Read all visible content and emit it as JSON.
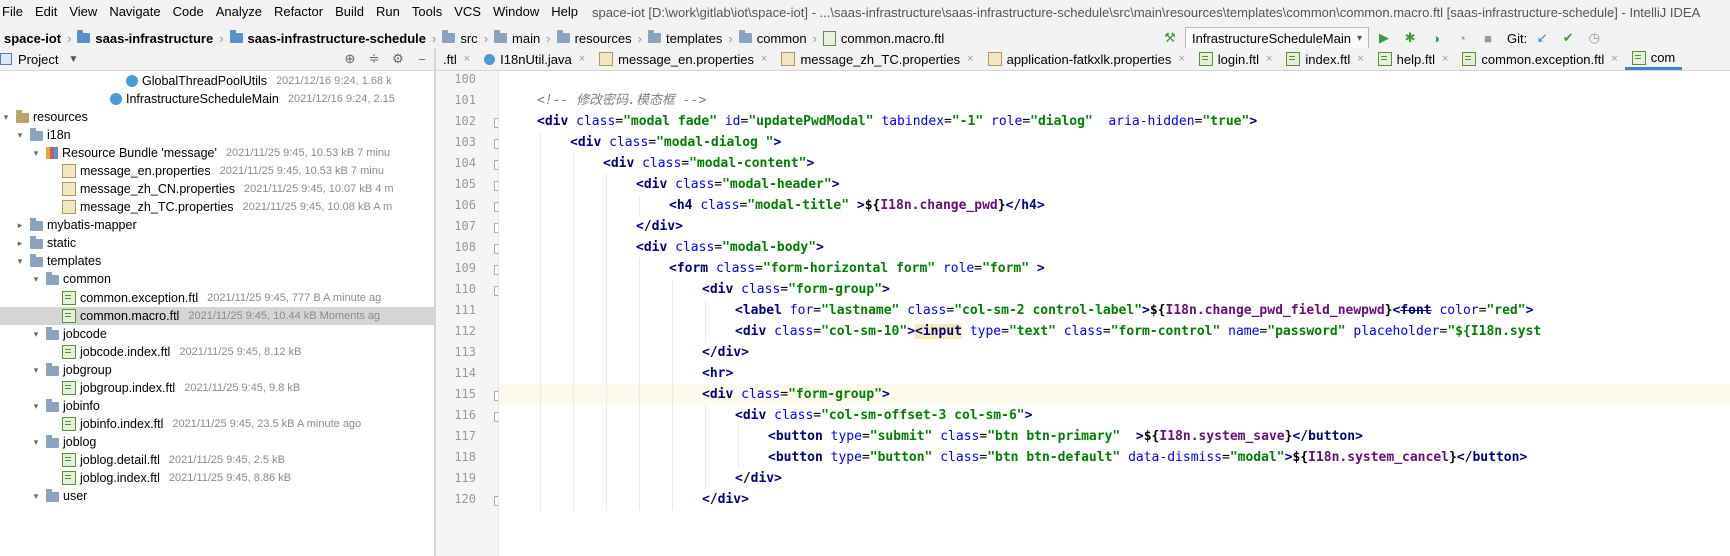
{
  "menu": [
    "File",
    "Edit",
    "View",
    "Navigate",
    "Code",
    "Analyze",
    "Refactor",
    "Build",
    "Run",
    "Tools",
    "VCS",
    "Window",
    "Help"
  ],
  "window_title": "space-iot [D:\\work\\gitlab\\iot\\space-iot] - ...\\saas-infrastructure\\saas-infrastructure-schedule\\src\\main\\resources\\templates\\common\\common.macro.ftl [saas-infrastructure-schedule] - IntelliJ IDEA",
  "breadcrumb": [
    "space-iot",
    "saas-infrastructure",
    "saas-infrastructure-schedule",
    "src",
    "main",
    "resources",
    "templates",
    "common",
    "common.macro.ftl"
  ],
  "run_config": "InfrastructureScheduleMain",
  "git_label": "Git:",
  "project_panel": {
    "title": "Project",
    "dropdown_icon": "triangle-down-icon",
    "tools": [
      "target-icon",
      "collapse-icon",
      "gear-icon",
      "minimize-icon"
    ]
  },
  "tree": [
    {
      "level": 11,
      "type": "class",
      "name": "GlobalThreadPoolUtils",
      "meta": "2021/12/16 9:24, 1.68 k"
    },
    {
      "level": 10,
      "type": "class",
      "name": "InfrastructureScheduleMain",
      "meta": "2021/12/16 9:24, 2.15"
    },
    {
      "level": 3,
      "type": "res-folder",
      "arrow": "▾",
      "name": "resources",
      "meta": ""
    },
    {
      "level": 4,
      "type": "folder",
      "arrow": "▾",
      "name": "i18n",
      "meta": ""
    },
    {
      "level": 5,
      "type": "bundle",
      "arrow": "▾",
      "name": "Resource Bundle 'message'",
      "meta": "2021/11/25 9:45, 10.53 kB 7 minu"
    },
    {
      "level": 7,
      "type": "props",
      "name": "message_en.properties",
      "meta": "2021/11/25 9:45, 10.53 kB 7 minu"
    },
    {
      "level": 7,
      "type": "props",
      "name": "message_zh_CN.properties",
      "meta": "2021/11/25 9:45, 10.07 kB 4 m"
    },
    {
      "level": 7,
      "type": "props",
      "name": "message_zh_TC.properties",
      "meta": "2021/11/25 9:45, 10.08 kB A m"
    },
    {
      "level": 4,
      "type": "folder",
      "arrow": "▸",
      "name": "mybatis-mapper",
      "meta": ""
    },
    {
      "level": 4,
      "type": "folder",
      "arrow": "▸",
      "name": "static",
      "meta": ""
    },
    {
      "level": 4,
      "type": "folder",
      "arrow": "▾",
      "name": "templates",
      "meta": ""
    },
    {
      "level": 5,
      "type": "folder",
      "arrow": "▾",
      "name": "common",
      "meta": ""
    },
    {
      "level": 7,
      "type": "ftl",
      "name": "common.exception.ftl",
      "meta": "2021/11/25 9:45, 777 B A minute ag"
    },
    {
      "level": 7,
      "type": "ftl",
      "name": "common.macro.ftl",
      "meta": "2021/11/25 9:45, 10.44 kB Moments ag",
      "selected": true
    },
    {
      "level": 5,
      "type": "folder",
      "arrow": "▾",
      "name": "jobcode",
      "meta": ""
    },
    {
      "level": 7,
      "type": "ftl",
      "name": "jobcode.index.ftl",
      "meta": "2021/11/25 9:45, 8.12 kB"
    },
    {
      "level": 5,
      "type": "folder",
      "arrow": "▾",
      "name": "jobgroup",
      "meta": ""
    },
    {
      "level": 7,
      "type": "ftl",
      "name": "jobgroup.index.ftl",
      "meta": "2021/11/25 9:45, 9.8 kB"
    },
    {
      "level": 5,
      "type": "folder",
      "arrow": "▾",
      "name": "jobinfo",
      "meta": ""
    },
    {
      "level": 7,
      "type": "ftl",
      "name": "jobinfo.index.ftl",
      "meta": "2021/11/25 9:45, 23.5 kB A minute ago"
    },
    {
      "level": 5,
      "type": "folder",
      "arrow": "▾",
      "name": "joblog",
      "meta": ""
    },
    {
      "level": 7,
      "type": "ftl",
      "name": "joblog.detail.ftl",
      "meta": "2021/11/25 9:45, 2.5 kB"
    },
    {
      "level": 7,
      "type": "ftl",
      "name": "joblog.index.ftl",
      "meta": "2021/11/25 9:45, 8.86 kB"
    },
    {
      "level": 5,
      "type": "folder",
      "arrow": "▾",
      "name": "user",
      "meta": ""
    }
  ],
  "tabs": [
    {
      "name": ".ftl",
      "icon": "none",
      "active": false
    },
    {
      "name": "I18nUtil.java",
      "icon": "java",
      "active": false
    },
    {
      "name": "message_en.properties",
      "icon": "props",
      "active": false
    },
    {
      "name": "message_zh_TC.properties",
      "icon": "props",
      "active": false
    },
    {
      "name": "application-fatkxlk.properties",
      "icon": "props",
      "active": false
    },
    {
      "name": "login.ftl",
      "icon": "ftl",
      "active": false
    },
    {
      "name": "index.ftl",
      "icon": "ftl",
      "active": false
    },
    {
      "name": "help.ftl",
      "icon": "ftl",
      "active": false
    },
    {
      "name": "common.exception.ftl",
      "icon": "ftl",
      "active": false
    },
    {
      "name": "com",
      "icon": "ftl",
      "active": true
    }
  ],
  "code_lines": [
    {
      "n": "100",
      "indent": 0,
      "segs": []
    },
    {
      "n": "101",
      "indent": 0,
      "segs": [
        [
          "comment",
          "<!-- 修改密码.模态框 -->"
        ]
      ]
    },
    {
      "n": "102",
      "indent": 0,
      "segs": [
        [
          "tag",
          "<div"
        ],
        [
          "plain",
          " "
        ],
        [
          "attr",
          "class"
        ],
        [
          "plain",
          "="
        ],
        [
          "val",
          "\"modal fade\""
        ],
        [
          "plain",
          " "
        ],
        [
          "attr",
          "id"
        ],
        [
          "plain",
          "="
        ],
        [
          "val",
          "\"updatePwdModal\""
        ],
        [
          "plain",
          " "
        ],
        [
          "attr",
          "tabindex"
        ],
        [
          "plain",
          "="
        ],
        [
          "val",
          "\"-1\""
        ],
        [
          "plain",
          " "
        ],
        [
          "attr",
          "role"
        ],
        [
          "plain",
          "="
        ],
        [
          "val",
          "\"dialog\""
        ],
        [
          "plain",
          "  "
        ],
        [
          "attr",
          "aria-hidden"
        ],
        [
          "plain",
          "="
        ],
        [
          "val",
          "\"true\""
        ],
        [
          "tag",
          ">"
        ]
      ]
    },
    {
      "n": "103",
      "indent": 1,
      "segs": [
        [
          "tag",
          "<div"
        ],
        [
          "plain",
          " "
        ],
        [
          "attr",
          "class"
        ],
        [
          "plain",
          "="
        ],
        [
          "val",
          "\"modal-dialog \""
        ],
        [
          "tag",
          ">"
        ]
      ]
    },
    {
      "n": "104",
      "indent": 2,
      "segs": [
        [
          "tag",
          "<div"
        ],
        [
          "plain",
          " "
        ],
        [
          "attr",
          "class"
        ],
        [
          "plain",
          "="
        ],
        [
          "val",
          "\"modal-content\""
        ],
        [
          "tag",
          ">"
        ]
      ]
    },
    {
      "n": "105",
      "indent": 3,
      "segs": [
        [
          "tag",
          "<div"
        ],
        [
          "plain",
          " "
        ],
        [
          "attr",
          "class"
        ],
        [
          "plain",
          "="
        ],
        [
          "val",
          "\"modal-header\""
        ],
        [
          "tag",
          ">"
        ]
      ]
    },
    {
      "n": "106",
      "indent": 4,
      "segs": [
        [
          "tag",
          "<h4"
        ],
        [
          "plain",
          " "
        ],
        [
          "attr",
          "class"
        ],
        [
          "plain",
          "="
        ],
        [
          "val",
          "\"modal-title\""
        ],
        [
          "plain",
          " "
        ],
        [
          "tag",
          ">"
        ],
        [
          "expr",
          "${"
        ],
        [
          "expr-var",
          "I18n.change_pwd"
        ],
        [
          "expr",
          "}"
        ],
        [
          "tag",
          "</h4>"
        ]
      ]
    },
    {
      "n": "107",
      "indent": 3,
      "segs": [
        [
          "tag",
          "</div>"
        ]
      ]
    },
    {
      "n": "108",
      "indent": 3,
      "segs": [
        [
          "tag",
          "<div"
        ],
        [
          "plain",
          " "
        ],
        [
          "attr",
          "class"
        ],
        [
          "plain",
          "="
        ],
        [
          "val",
          "\"modal-body\""
        ],
        [
          "tag",
          ">"
        ]
      ]
    },
    {
      "n": "109",
      "indent": 4,
      "segs": [
        [
          "tag",
          "<form"
        ],
        [
          "plain",
          " "
        ],
        [
          "attr",
          "class"
        ],
        [
          "plain",
          "="
        ],
        [
          "val",
          "\"form-horizontal form\""
        ],
        [
          "plain",
          " "
        ],
        [
          "attr",
          "role"
        ],
        [
          "plain",
          "="
        ],
        [
          "val",
          "\"form\""
        ],
        [
          "plain",
          " "
        ],
        [
          "tag",
          ">"
        ]
      ]
    },
    {
      "n": "110",
      "indent": 5,
      "segs": [
        [
          "tag",
          "<div"
        ],
        [
          "plain",
          " "
        ],
        [
          "attr",
          "class"
        ],
        [
          "plain",
          "="
        ],
        [
          "val",
          "\"form-group\""
        ],
        [
          "tag",
          ">"
        ]
      ]
    },
    {
      "n": "111",
      "indent": 6,
      "segs": [
        [
          "tag",
          "<label"
        ],
        [
          "plain",
          " "
        ],
        [
          "attr",
          "for"
        ],
        [
          "plain",
          "="
        ],
        [
          "val",
          "\"lastname\""
        ],
        [
          "plain",
          " "
        ],
        [
          "attr",
          "class"
        ],
        [
          "plain",
          "="
        ],
        [
          "val",
          "\"col-sm-2 control-label\""
        ],
        [
          "tag",
          ">"
        ],
        [
          "expr",
          "${"
        ],
        [
          "expr-var",
          "I18n.change_pwd_field_newpwd"
        ],
        [
          "expr",
          "}"
        ],
        [
          "tag",
          "<"
        ],
        [
          "tag-strike",
          "font"
        ],
        [
          "plain",
          " "
        ],
        [
          "attr",
          "color"
        ],
        [
          "plain",
          "="
        ],
        [
          "val",
          "\"red\""
        ],
        [
          "tag",
          ">"
        ]
      ]
    },
    {
      "n": "112",
      "indent": 6,
      "segs": [
        [
          "tag",
          "<div"
        ],
        [
          "plain",
          " "
        ],
        [
          "attr",
          "class"
        ],
        [
          "plain",
          "="
        ],
        [
          "val",
          "\"col-sm-10\""
        ],
        [
          "tag",
          ">"
        ],
        [
          "tag-hl",
          "<input"
        ],
        [
          "plain",
          " "
        ],
        [
          "attr",
          "type"
        ],
        [
          "plain",
          "="
        ],
        [
          "val",
          "\"text\""
        ],
        [
          "plain",
          " "
        ],
        [
          "attr",
          "class"
        ],
        [
          "plain",
          "="
        ],
        [
          "val",
          "\"form-control\""
        ],
        [
          "plain",
          " "
        ],
        [
          "attr",
          "name"
        ],
        [
          "plain",
          "="
        ],
        [
          "val",
          "\"password\""
        ],
        [
          "plain",
          " "
        ],
        [
          "attr",
          "placeholder"
        ],
        [
          "plain",
          "="
        ],
        [
          "val",
          "\"${I18n.syst"
        ]
      ]
    },
    {
      "n": "113",
      "indent": 5,
      "segs": [
        [
          "tag",
          "</div>"
        ]
      ]
    },
    {
      "n": "114",
      "indent": 5,
      "segs": [
        [
          "tag",
          "<hr>"
        ]
      ]
    },
    {
      "n": "115",
      "indent": 5,
      "current": true,
      "segs": [
        [
          "tag",
          "<div"
        ],
        [
          "plain",
          " "
        ],
        [
          "attr",
          "class"
        ],
        [
          "plain",
          "="
        ],
        [
          "val",
          "\"form-group\""
        ],
        [
          "tag",
          ">"
        ]
      ]
    },
    {
      "n": "116",
      "indent": 6,
      "segs": [
        [
          "tag",
          "<div"
        ],
        [
          "plain",
          " "
        ],
        [
          "attr",
          "class"
        ],
        [
          "plain",
          "="
        ],
        [
          "val",
          "\"col-sm-offset-3 col-sm-6\""
        ],
        [
          "tag",
          ">"
        ]
      ]
    },
    {
      "n": "117",
      "indent": 7,
      "segs": [
        [
          "tag",
          "<button"
        ],
        [
          "plain",
          " "
        ],
        [
          "attr",
          "type"
        ],
        [
          "plain",
          "="
        ],
        [
          "val",
          "\"submit\""
        ],
        [
          "plain",
          " "
        ],
        [
          "attr",
          "class"
        ],
        [
          "plain",
          "="
        ],
        [
          "val",
          "\"btn btn-primary\""
        ],
        [
          "plain",
          "  "
        ],
        [
          "tag",
          ">"
        ],
        [
          "expr",
          "${"
        ],
        [
          "expr-var",
          "I18n.system_save"
        ],
        [
          "expr",
          "}"
        ],
        [
          "tag",
          "</button>"
        ]
      ]
    },
    {
      "n": "118",
      "indent": 7,
      "segs": [
        [
          "tag",
          "<button"
        ],
        [
          "plain",
          " "
        ],
        [
          "attr",
          "type"
        ],
        [
          "plain",
          "="
        ],
        [
          "val",
          "\"button\""
        ],
        [
          "plain",
          " "
        ],
        [
          "attr",
          "class"
        ],
        [
          "plain",
          "="
        ],
        [
          "val",
          "\"btn btn-default\""
        ],
        [
          "plain",
          " "
        ],
        [
          "attr",
          "data-dismiss"
        ],
        [
          "plain",
          "="
        ],
        [
          "val",
          "\"modal\""
        ],
        [
          "tag",
          ">"
        ],
        [
          "expr",
          "${"
        ],
        [
          "expr-var",
          "I18n.system_cancel"
        ],
        [
          "expr",
          "}"
        ],
        [
          "tag",
          "</button>"
        ]
      ]
    },
    {
      "n": "119",
      "indent": 6,
      "segs": [
        [
          "tag",
          "</div>"
        ]
      ]
    },
    {
      "n": "120",
      "indent": 5,
      "segs": [
        [
          "tag",
          "</div>"
        ]
      ]
    }
  ]
}
